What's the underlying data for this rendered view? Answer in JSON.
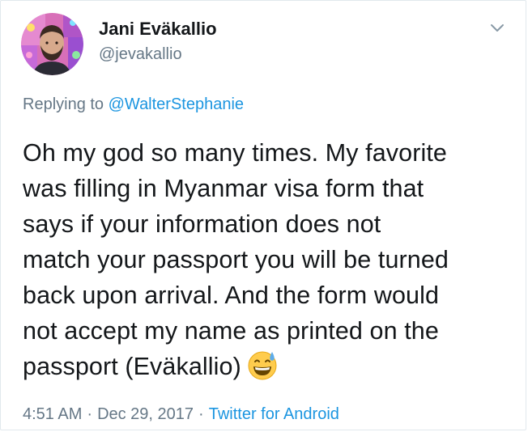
{
  "author": {
    "display_name": "Jani Eväkallio",
    "handle": "@jevakallio"
  },
  "reply": {
    "prefix": "Replying to ",
    "to_handle": "@WalterStephanie"
  },
  "tweet": {
    "lines": [
      "Oh my god so many times. My favorite",
      "was filling in Myanmar visa form that",
      "says if your information does not",
      "match your passport you will be turned",
      "back upon arrival. And the form would",
      "not accept my name as printed on the",
      "passport (Eväkallio)"
    ],
    "emoji": "grinning-face-with-sweat-icon"
  },
  "meta": {
    "time": "4:51 AM",
    "separator": "·",
    "date": "Dec 29, 2017",
    "source": "Twitter for Android"
  },
  "colors": {
    "link": "#1b95e0",
    "secondary": "#657786",
    "text": "#14171a",
    "border": "#e1e8ed"
  },
  "icons": {
    "menu": "chevron-down-icon",
    "avatar": "avatar"
  }
}
